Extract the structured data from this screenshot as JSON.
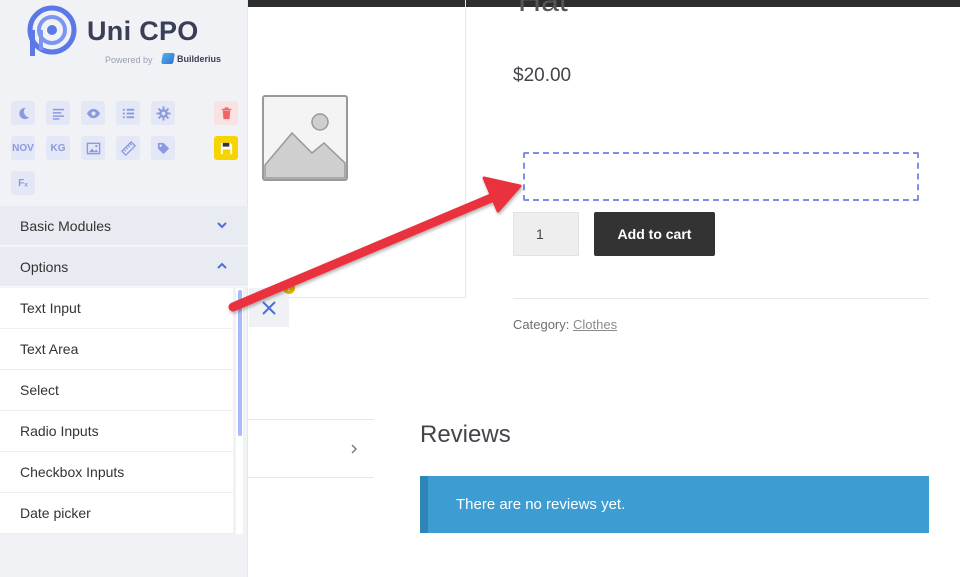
{
  "brand": {
    "name": "Uni CPO",
    "powered_by": "Powered by",
    "partner": "Builderius",
    "accent": "#5b78e6"
  },
  "toolbar": {
    "nov_label": "NOV",
    "kg_label": "KG",
    "fx_label": "Fₓ",
    "icons": [
      "moon-icon",
      "align-left-icon",
      "eye-icon",
      "list-icon",
      "gear-icon",
      "trash-icon",
      "nov-icon",
      "kg-icon",
      "image-icon",
      "ruler-icon",
      "tag-icon",
      "save-icon",
      "formula-icon"
    ]
  },
  "sidebar": {
    "sections": [
      {
        "label": "Basic Modules",
        "expanded": false
      },
      {
        "label": "Options",
        "expanded": true
      }
    ],
    "options": [
      {
        "label": "Text Input"
      },
      {
        "label": "Text Area"
      },
      {
        "label": "Select"
      },
      {
        "label": "Radio Inputs"
      },
      {
        "label": "Checkbox Inputs"
      },
      {
        "label": "Date picker"
      }
    ]
  },
  "product": {
    "title_fragment": "Hat",
    "price": "$20.00",
    "quantity": "1",
    "add_to_cart": "Add to cart",
    "category_label": "Category:",
    "category_value": "Clothes"
  },
  "reviews": {
    "title": "Reviews",
    "notice": "There are no reviews yet."
  },
  "warning_badge": "!",
  "colors": {
    "sidebar_bg": "#f1f2f6",
    "button_dark": "#333333",
    "notice_bg": "#3d9cd2",
    "arrow": "#e9333c",
    "save_yellow": "#f5d400"
  }
}
